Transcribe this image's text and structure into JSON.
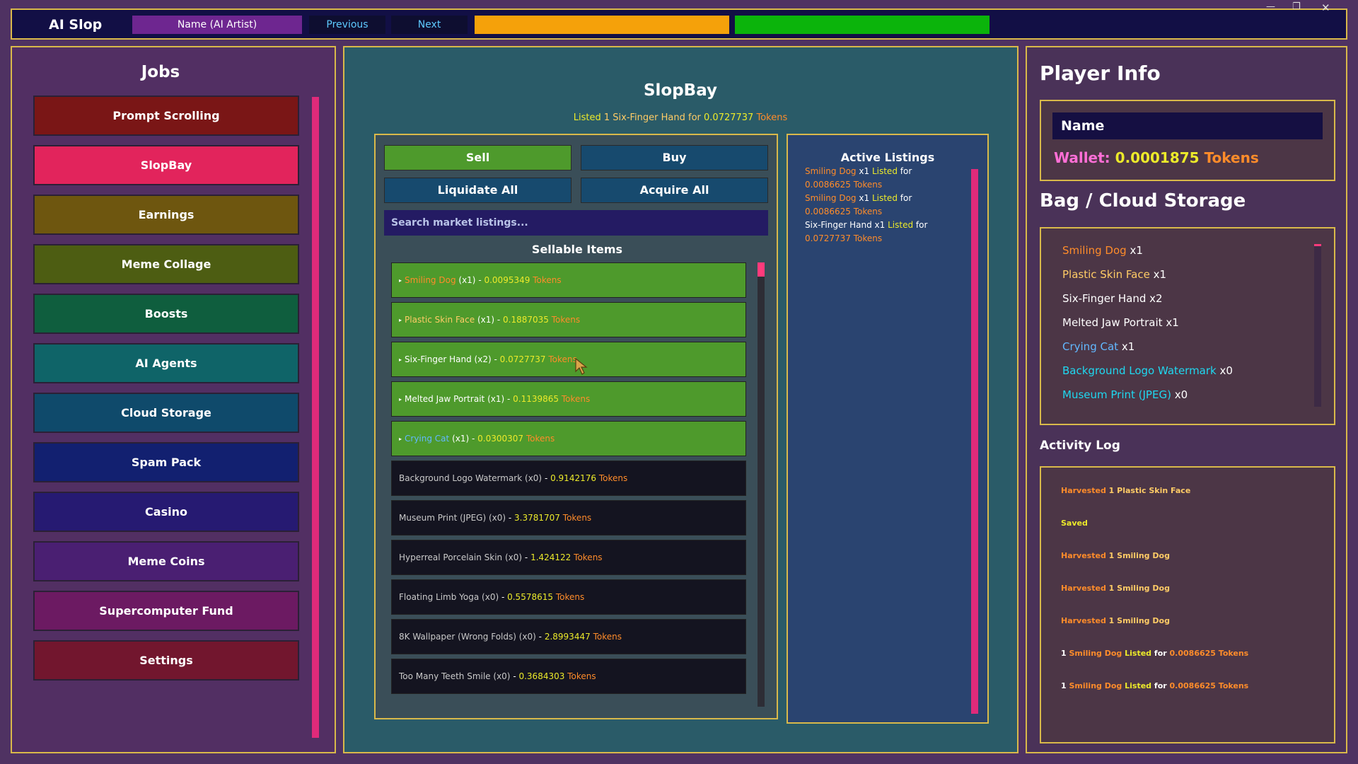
{
  "window": {
    "title": "AI Slop",
    "name_label": "Name (AI Artist)",
    "prev_label": "Previous",
    "next_label": "Next",
    "min_icon": "minimize-icon",
    "max_icon": "maximize-icon",
    "close_icon": "close-icon",
    "close_glyph": "✕",
    "max_glyph": "❐",
    "min_glyph": "—"
  },
  "jobs": {
    "title": "Jobs",
    "items": [
      {
        "label": "Prompt Scrolling",
        "color": "#7a1616"
      },
      {
        "label": "SlopBay",
        "color": "#e2245c"
      },
      {
        "label": "Earnings",
        "color": "#6e560f"
      },
      {
        "label": "Meme Collage",
        "color": "#4d5d12"
      },
      {
        "label": "Boosts",
        "color": "#0f5e3e"
      },
      {
        "label": "AI Agents",
        "color": "#0f6468"
      },
      {
        "label": "Cloud Storage",
        "color": "#0f4a6b"
      },
      {
        "label": "Spam Pack",
        "color": "#122070"
      },
      {
        "label": "Casino",
        "color": "#261a72"
      },
      {
        "label": "Meme Coins",
        "color": "#4a1f72"
      },
      {
        "label": "Supercomputer Fund",
        "color": "#6c1a62"
      },
      {
        "label": "Settings",
        "color": "#72162e"
      }
    ]
  },
  "slopbay": {
    "title": "SlopBay",
    "status": {
      "listed": "Listed",
      "mid": "1 Six-Finger Hand for",
      "amount": "0.0727737",
      "tokens": "Tokens"
    },
    "sell_label": "Sell",
    "buy_label": "Buy",
    "liquidate_label": "Liquidate All",
    "acquire_label": "Acquire All",
    "search_placeholder": "Search market listings...",
    "sellable_title": "Sellable Items",
    "sellable": [
      {
        "name": "Smiling Dog",
        "qty": "(x1)",
        "price": "0.0095349",
        "style": "green",
        "name_color": "o"
      },
      {
        "name": "Plastic Skin Face",
        "qty": "(x1)",
        "price": "0.1887035",
        "style": "green",
        "name_color": "lo"
      },
      {
        "name": "Six-Finger Hand",
        "qty": "(x2)",
        "price": "0.0727737",
        "style": "green",
        "name_color": "w"
      },
      {
        "name": "Melted Jaw Portrait",
        "qty": "(x1)",
        "price": "0.1139865",
        "style": "green",
        "name_color": "w"
      },
      {
        "name": "Crying Cat",
        "qty": "(x1)",
        "price": "0.0300307",
        "style": "green",
        "name_color": "b"
      },
      {
        "name": "Background Logo Watermark",
        "qty": "(x0)",
        "price": "0.9142176",
        "style": "dark",
        "name_color": "gy"
      },
      {
        "name": "Museum Print (JPEG)",
        "qty": "(x0)",
        "price": "3.3781707",
        "style": "dark",
        "name_color": "gy"
      },
      {
        "name": "Hyperreal Porcelain Skin",
        "qty": "(x0)",
        "price": "1.424122",
        "style": "dark",
        "name_color": "gy"
      },
      {
        "name": "Floating Limb Yoga",
        "qty": "(x0)",
        "price": "0.5578615",
        "style": "dark",
        "name_color": "gy"
      },
      {
        "name": "8K Wallpaper (Wrong Folds)",
        "qty": "(x0)",
        "price": "2.8993447",
        "style": "dark",
        "name_color": "gy"
      },
      {
        "name": "Too Many Teeth Smile",
        "qty": "(x0)",
        "price": "0.3684303",
        "style": "dark",
        "name_color": "gy"
      }
    ],
    "tokens_word": "Tokens",
    "active_title": "Active Listings",
    "active": [
      {
        "name": "Smiling Dog",
        "qty": "x1",
        "listed": "Listed",
        "for": "for",
        "price": "0.0086625",
        "tokens": "Tokens",
        "name_color": "o"
      },
      {
        "name": "Smiling Dog",
        "qty": "x1",
        "listed": "Listed",
        "for": "for",
        "price": "0.0086625",
        "tokens": "Tokens",
        "name_color": "o"
      },
      {
        "name": "Six-Finger Hand",
        "qty": "x1",
        "listed": "Listed",
        "for": "for",
        "price": "0.0727737",
        "tokens": "Tokens",
        "name_color": "w"
      }
    ]
  },
  "player": {
    "title": "Player Info",
    "name": "Name",
    "wallet_label": "Wallet:",
    "wallet_value": "0.0001875",
    "wallet_tokens": "Tokens",
    "bag_title": "Bag / Cloud Storage",
    "bag": [
      {
        "name": "Smiling Dog",
        "qty": "x1",
        "name_color": "o"
      },
      {
        "name": "Plastic Skin Face",
        "qty": "x1",
        "name_color": "lo"
      },
      {
        "name": "Six-Finger Hand",
        "qty": "x2",
        "name_color": "w"
      },
      {
        "name": "Melted Jaw Portrait",
        "qty": "x1",
        "name_color": "w"
      },
      {
        "name": "Crying Cat",
        "qty": "x1",
        "name_color": "b"
      },
      {
        "name": "Background Logo Watermark",
        "qty": "x0",
        "name_color": "c"
      },
      {
        "name": "Museum Print (JPEG)",
        "qty": "x0",
        "name_color": "c"
      }
    ],
    "log_title": "Activity Log",
    "log": [
      {
        "a": "Harvested",
        "b": "1 Plastic Skin Face",
        "c": "",
        "d": "",
        "e": ""
      },
      {
        "a": "Saved",
        "b": "",
        "c": "",
        "d": "",
        "e": ""
      },
      {
        "a": "Harvested",
        "b": "1 Smiling Dog",
        "c": "",
        "d": "",
        "e": ""
      },
      {
        "a": "Harvested",
        "b": "1 Smiling Dog",
        "c": "",
        "d": "",
        "e": ""
      },
      {
        "a": "Harvested",
        "b": "1 Smiling Dog",
        "c": "",
        "d": "",
        "e": ""
      },
      {
        "a": "1",
        "b": "Smiling Dog",
        "c": "Listed",
        "d": "for",
        "e": "0.0086625 Tokens"
      },
      {
        "a": "1",
        "b": "Smiling Dog",
        "c": "Listed",
        "d": "for",
        "e": "0.0086625 Tokens"
      }
    ]
  },
  "colors": {
    "accent_border": "#d9b94a",
    "scrollbar": "#e02a7a",
    "token_orange": "#ff8c2a",
    "token_yellow": "#ecea2a"
  }
}
